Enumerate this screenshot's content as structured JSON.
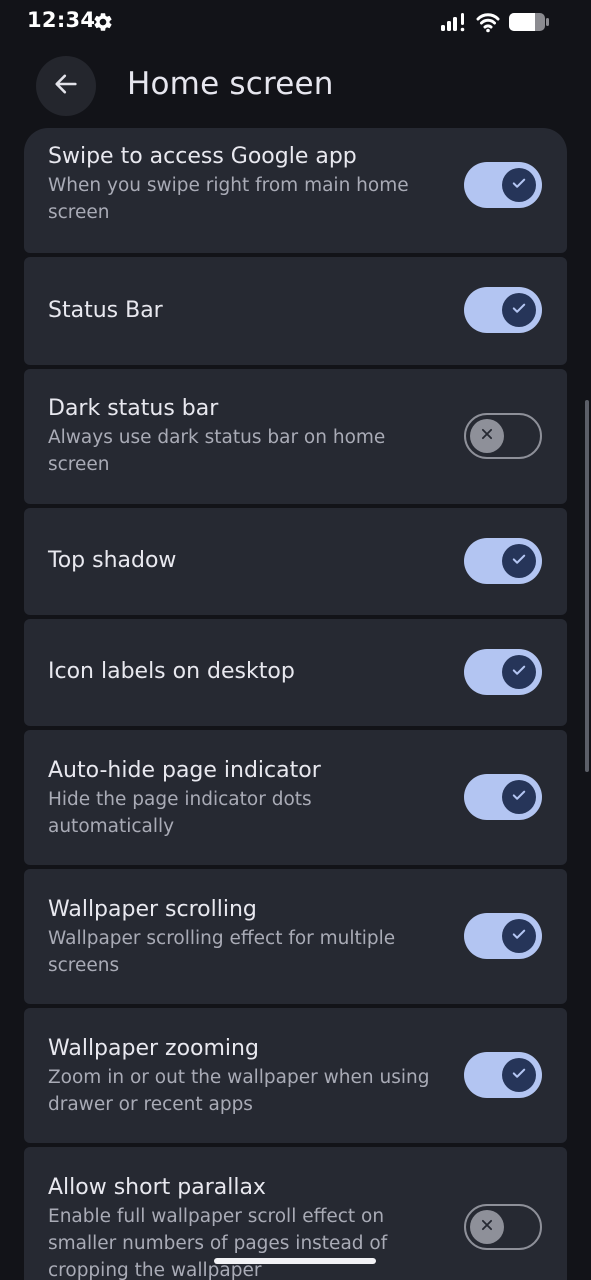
{
  "status_bar": {
    "time": "12:34",
    "settings_icon": "gear-icon",
    "signal_icon": "signal-icon",
    "wifi_icon": "wifi-icon",
    "battery_icon": "battery-icon"
  },
  "header": {
    "back_icon": "arrow-left-icon",
    "title": "Home screen"
  },
  "colors": {
    "background": "#121318",
    "card": "#262932",
    "toggle_on_track": "#b3c5f2",
    "toggle_on_knob": "#263559",
    "toggle_off_border": "#8e9099"
  },
  "settings": [
    {
      "title": "Swipe to access Google app",
      "description": "When you swipe right from main home screen",
      "enabled": true
    },
    {
      "title": "Status Bar",
      "description": "",
      "enabled": true
    },
    {
      "title": "Dark status bar",
      "description": "Always use dark status bar on home screen",
      "enabled": false
    },
    {
      "title": "Top shadow",
      "description": "",
      "enabled": true
    },
    {
      "title": "Icon labels on desktop",
      "description": "",
      "enabled": true
    },
    {
      "title": "Auto-hide page indicator",
      "description": "Hide the page indicator dots automatically",
      "enabled": true
    },
    {
      "title": "Wallpaper scrolling",
      "description": "Wallpaper scrolling effect for multiple screens",
      "enabled": true
    },
    {
      "title": "Wallpaper zooming",
      "description": "Zoom in or out the wallpaper when using drawer or recent apps",
      "enabled": true
    },
    {
      "title": "Allow short parallax",
      "description": "Enable full wallpaper scroll effect on smaller numbers of pages instead of cropping the wallpaper",
      "enabled": false
    }
  ]
}
